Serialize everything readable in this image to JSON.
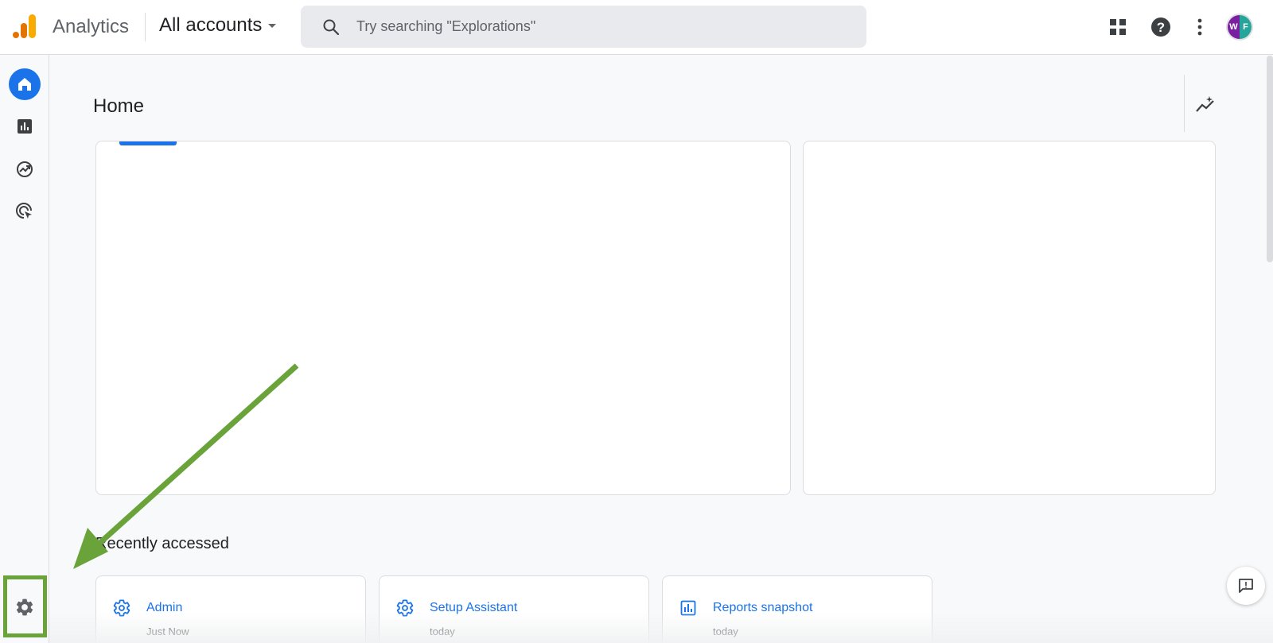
{
  "header": {
    "app_title": "Analytics",
    "account_picker": "All accounts",
    "search_placeholder": "Try searching \"Explorations\"",
    "icons": [
      "apps-grid-icon",
      "help-icon",
      "more-vert-icon"
    ],
    "avatar_initials": [
      "W",
      "F"
    ]
  },
  "sidebar": {
    "items": [
      {
        "name": "home",
        "icon": "home-icon",
        "active": true
      },
      {
        "name": "reports",
        "icon": "bar-chart-icon",
        "active": false
      },
      {
        "name": "explore",
        "icon": "explore-icon",
        "active": false
      },
      {
        "name": "advertising",
        "icon": "target-cursor-icon",
        "active": false
      }
    ],
    "admin": {
      "icon": "gear-icon"
    }
  },
  "main": {
    "title": "Home",
    "recent_title": "Recently accessed",
    "recent": [
      {
        "label": "Admin",
        "time": "Just Now",
        "icon": "gear-icon"
      },
      {
        "label": "Setup Assistant",
        "time": "today",
        "icon": "gear-icon"
      },
      {
        "label": "Reports snapshot",
        "time": "today",
        "icon": "bar-chart-icon"
      }
    ]
  },
  "colors": {
    "accent": "#1a73e8",
    "annotation": "#6aa33a"
  }
}
